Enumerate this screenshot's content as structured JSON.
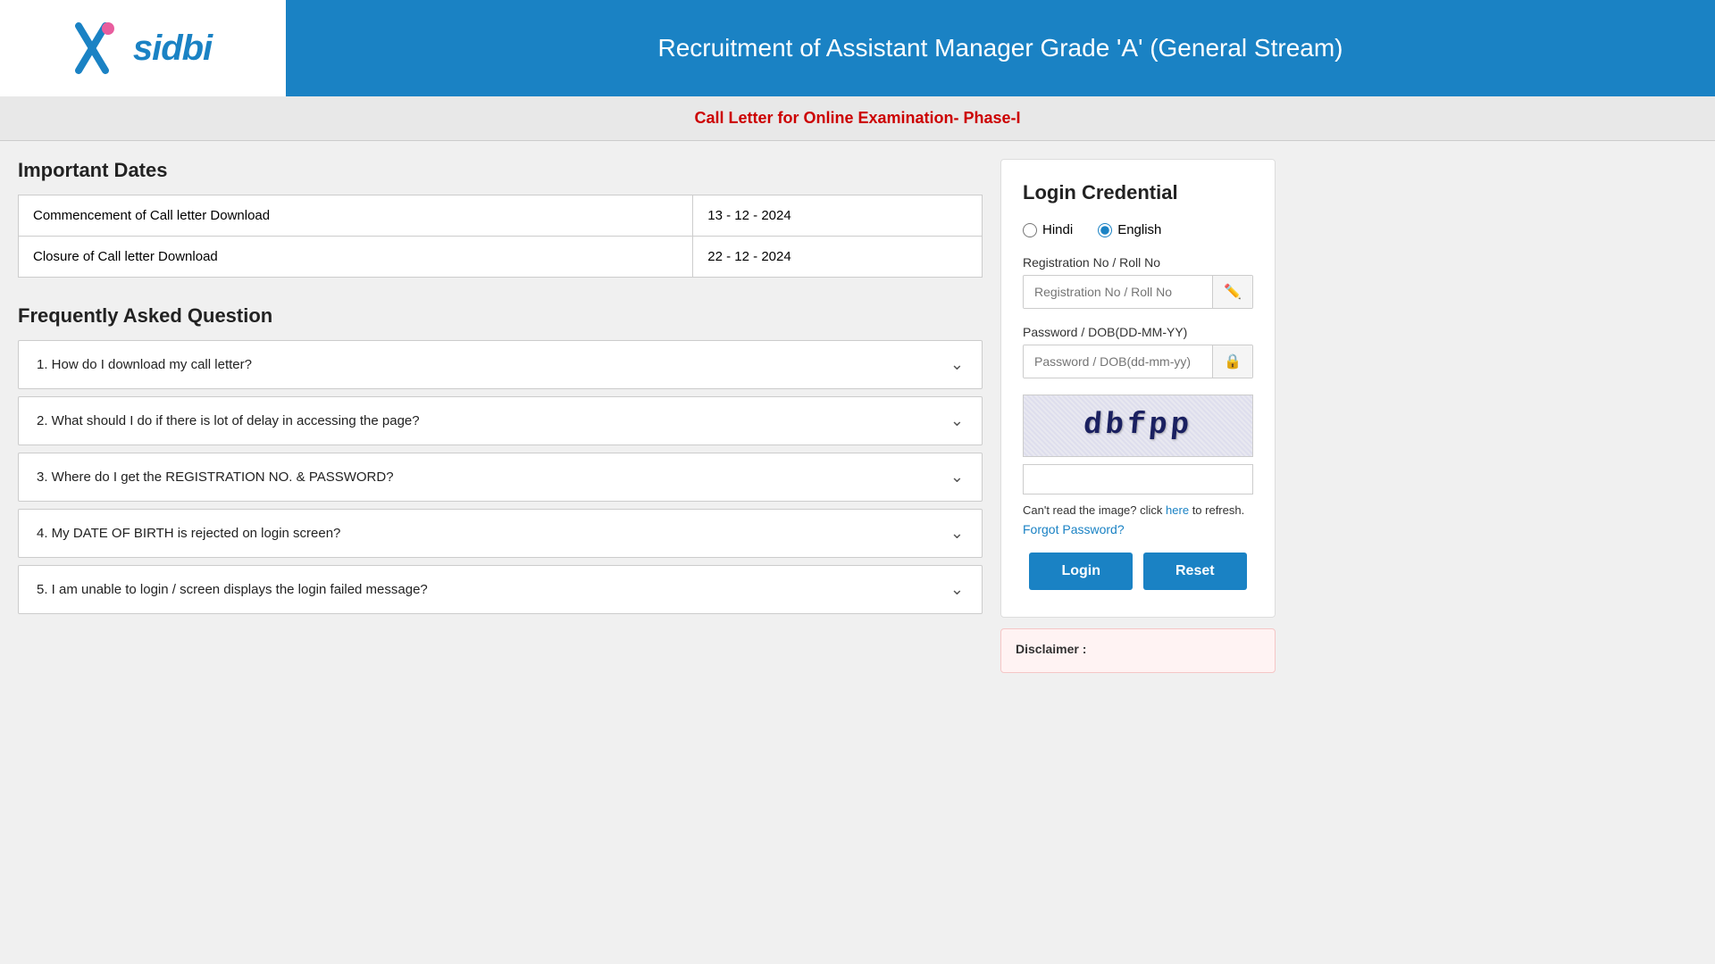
{
  "header": {
    "title": "Recruitment of Assistant Manager Grade 'A' (General Stream)",
    "logo_alt": "SIDBI Logo"
  },
  "sub_header": {
    "text": "Call Letter for Online Examination- Phase-I"
  },
  "important_dates": {
    "section_title": "Important Dates",
    "rows": [
      {
        "label": "Commencement of Call letter Download",
        "date": "13 - 12 - 2024"
      },
      {
        "label": "Closure of Call letter Download",
        "date": "22 - 12 - 2024"
      }
    ]
  },
  "faq": {
    "section_title": "Frequently Asked Question",
    "items": [
      {
        "id": 1,
        "question": "1. How do I download my call letter?"
      },
      {
        "id": 2,
        "question": "2. What should I do if there is lot of delay in accessing the page?"
      },
      {
        "id": 3,
        "question": "3. Where do I get the REGISTRATION NO. & PASSWORD?"
      },
      {
        "id": 4,
        "question": "4. My DATE OF BIRTH is rejected on login screen?"
      },
      {
        "id": 5,
        "question": "5. I am unable to login / screen displays the login failed message?"
      }
    ]
  },
  "login": {
    "title": "Login Credential",
    "language_options": [
      {
        "value": "hindi",
        "label": "Hindi"
      },
      {
        "value": "english",
        "label": "English"
      }
    ],
    "registration_label": "Registration No / Roll No",
    "registration_placeholder": "Registration No / Roll No",
    "password_label": "Password / DOB(DD-MM-YY)",
    "password_placeholder": "Password / DOB(dd-mm-yy)",
    "captcha_text": "dbfpp",
    "captcha_refresh_text": "Can't read the image? click",
    "captcha_refresh_link": "here",
    "captcha_refresh_suffix": "to refresh.",
    "forgot_password": "Forgot Password?",
    "login_button": "Login",
    "reset_button": "Reset"
  },
  "disclaimer": {
    "title": "Disclaimer :"
  }
}
